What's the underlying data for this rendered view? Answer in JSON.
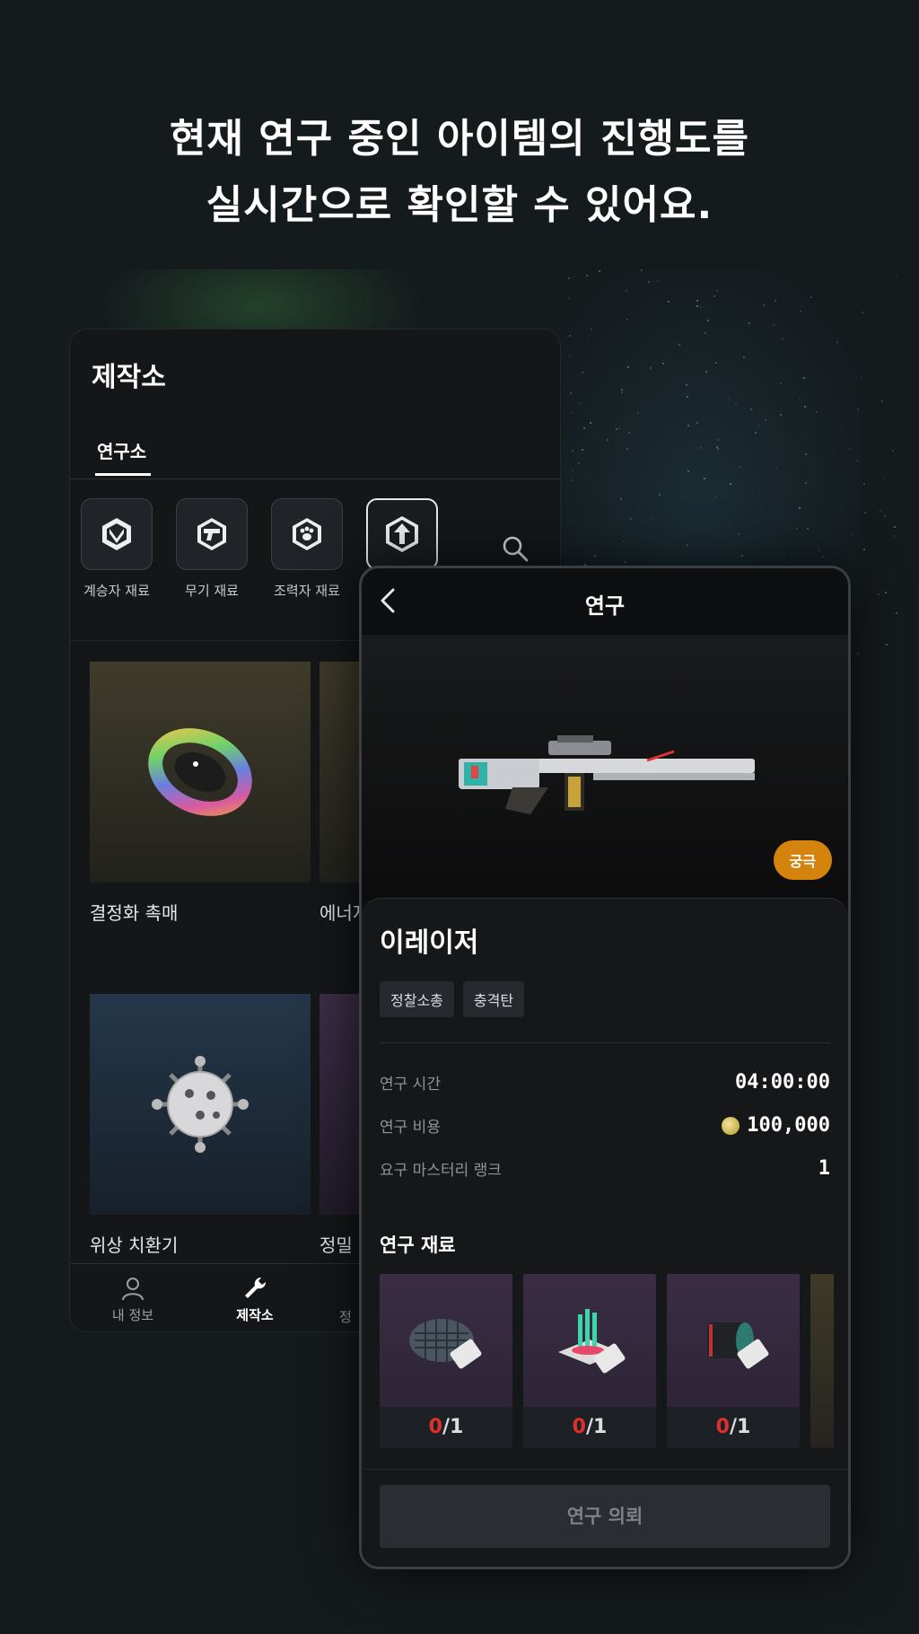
{
  "headline": {
    "line1": "현재 연구 중인 아이템의 진행도를",
    "line2": "실시간으로 확인할 수 있어요."
  },
  "workshop": {
    "title": "제작소",
    "tab": "연구소",
    "categories": [
      {
        "label": "계승자 재료",
        "icon": "shield-chevron-icon"
      },
      {
        "label": "무기 재료",
        "icon": "pistol-icon"
      },
      {
        "label": "조력자 재료",
        "icon": "paw-icon"
      },
      {
        "label": "",
        "icon": "upgrade-arrow-icon"
      }
    ],
    "search_icon": "search-icon",
    "items": [
      {
        "name": "결정화 촉매"
      },
      {
        "name": "에너지"
      },
      {
        "name": "위상 치환기"
      },
      {
        "name": "정밀"
      }
    ],
    "nav": [
      {
        "label": "내 정보",
        "icon": "person-icon"
      },
      {
        "label": "제작소",
        "icon": "wrench-icon"
      },
      {
        "label": "정",
        "icon": ""
      }
    ]
  },
  "detail": {
    "title": "연구",
    "rarity": "궁극",
    "name": "이레이저",
    "tags": [
      "정찰소총",
      "충격탄"
    ],
    "stats": [
      {
        "label": "연구 시간",
        "value": "04:00:00"
      },
      {
        "label": "연구 비용",
        "value": "100,000"
      },
      {
        "label": "요구 마스터리 랭크",
        "value": "1"
      }
    ],
    "materials_title": "연구 재료",
    "materials": [
      {
        "have": "0",
        "need": "/1"
      },
      {
        "have": "0",
        "need": "/1"
      },
      {
        "have": "0",
        "need": "/1"
      }
    ],
    "cta": "연구 의뢰"
  },
  "colors": {
    "background": "#151a1d",
    "rarity_badge": "#d4830c",
    "material_have": "#e0302c"
  }
}
